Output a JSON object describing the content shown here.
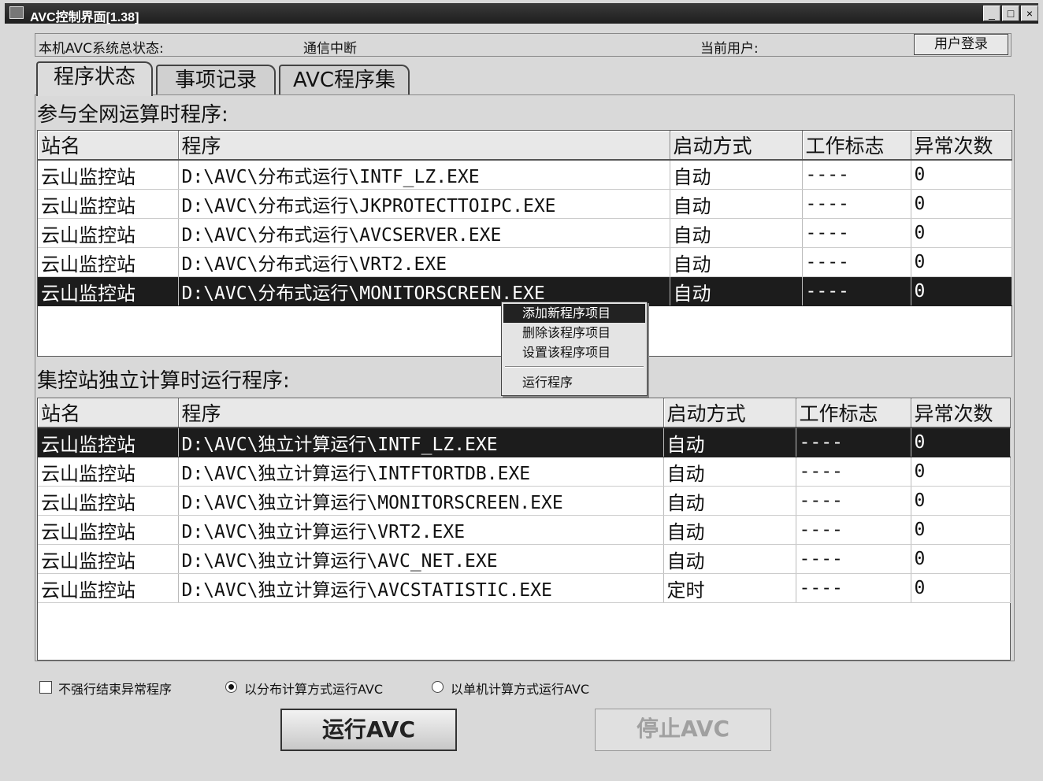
{
  "window": {
    "title": "AVC控制界面[1.38]",
    "min": "_",
    "max": "□",
    "close": "×"
  },
  "status": {
    "label": "本机AVC系统总状态:",
    "value": "通信中断",
    "user_label": "当前用户:",
    "login_button": "用户登录"
  },
  "tabs": [
    {
      "label": "程序状态",
      "active": true
    },
    {
      "label": "事项记录",
      "active": false
    },
    {
      "label": "AVC程序集",
      "active": false
    }
  ],
  "section1": {
    "title": "参与全网运算时程序:",
    "columns": [
      "站名",
      "程序",
      "启动方式",
      "工作标志",
      "异常次数"
    ],
    "rows": [
      [
        "云山监控站",
        "D:\\AVC\\分布式运行\\INTF_LZ.EXE",
        "自动",
        "----",
        "0"
      ],
      [
        "云山监控站",
        "D:\\AVC\\分布式运行\\JKPROTECTTOIPC.EXE",
        "自动",
        "----",
        "0"
      ],
      [
        "云山监控站",
        "D:\\AVC\\分布式运行\\AVCSERVER.EXE",
        "自动",
        "----",
        "0"
      ],
      [
        "云山监控站",
        "D:\\AVC\\分布式运行\\VRT2.EXE",
        "自动",
        "----",
        "0"
      ],
      [
        "云山监控站",
        "D:\\AVC\\分布式运行\\MONITORSCREEN.EXE",
        "自动",
        "----",
        "0"
      ]
    ]
  },
  "section2": {
    "title": "集控站独立计算时运行程序:",
    "columns": [
      "站名",
      "程序",
      "启动方式",
      "工作标志",
      "异常次数"
    ],
    "rows": [
      [
        "云山监控站",
        "D:\\AVC\\独立计算运行\\INTF_LZ.EXE",
        "自动",
        "----",
        "0"
      ],
      [
        "云山监控站",
        "D:\\AVC\\独立计算运行\\INTFTORTDB.EXE",
        "自动",
        "----",
        "0"
      ],
      [
        "云山监控站",
        "D:\\AVC\\独立计算运行\\MONITORSCREEN.EXE",
        "自动",
        "----",
        "0"
      ],
      [
        "云山监控站",
        "D:\\AVC\\独立计算运行\\VRT2.EXE",
        "自动",
        "----",
        "0"
      ],
      [
        "云山监控站",
        "D:\\AVC\\独立计算运行\\AVC_NET.EXE",
        "自动",
        "----",
        "0"
      ],
      [
        "云山监控站",
        "D:\\AVC\\独立计算运行\\AVCSTATISTIC.EXE",
        "定时",
        "----",
        "0"
      ]
    ]
  },
  "context_menu": {
    "items": [
      "添加新程序项目",
      "删除该程序项目",
      "设置该程序项目",
      "运行程序"
    ]
  },
  "options": {
    "no_force_kill": "不强行结束异常程序",
    "run_distributed": "以分布计算方式运行AVC",
    "run_standalone": "以单机计算方式运行AVC"
  },
  "buttons": {
    "run": "运行AVC",
    "stop": "停止AVC"
  }
}
